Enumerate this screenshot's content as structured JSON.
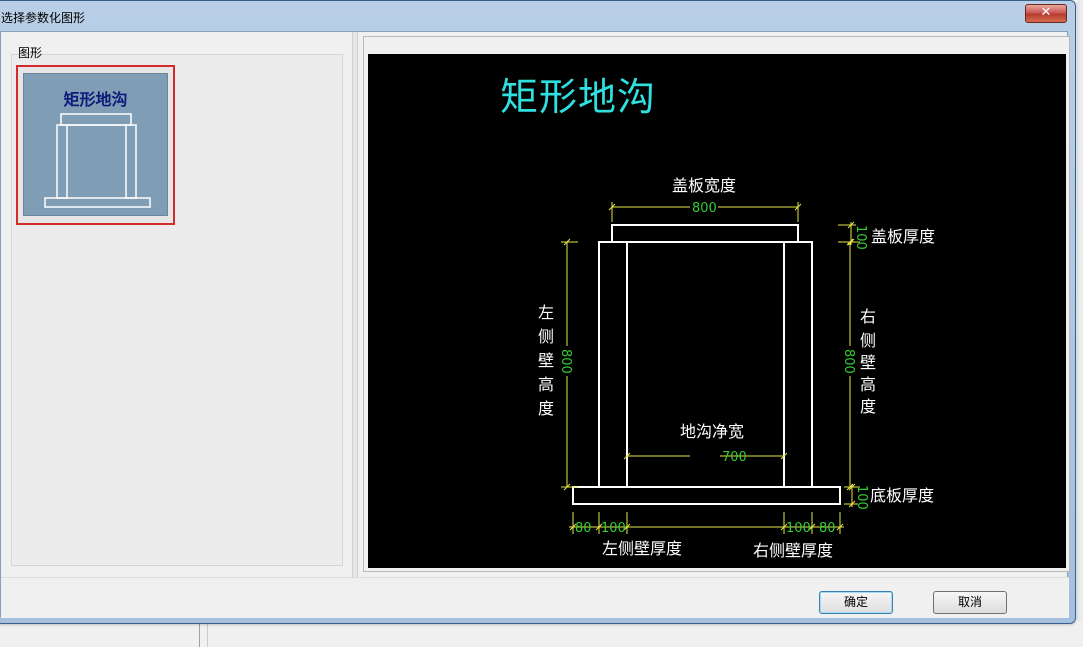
{
  "window": {
    "title": "选择参数化图形",
    "close_label": "✕"
  },
  "left_panel": {
    "group_label": "图形",
    "thumbnail": {
      "title": "矩形地沟",
      "selected": true
    }
  },
  "preview": {
    "title": "矩形地沟",
    "labels": {
      "cover_width": "盖板宽度",
      "cover_thickness": "盖板厚度",
      "left_wall_height": [
        "左",
        "侧",
        "壁",
        "高",
        "度"
      ],
      "right_wall_height": [
        "右",
        "侧",
        "壁",
        "高",
        "度"
      ],
      "clear_width": "地沟净宽",
      "bottom_thickness": "底板厚度",
      "left_wall_thickness": "左侧壁厚度",
      "right_wall_thickness": "右侧壁厚度"
    },
    "dims": {
      "cover_width": "800",
      "cover_thickness": "100",
      "left_wall_height": "800",
      "right_wall_height": "800",
      "clear_width": "700",
      "bottom_thickness": "100",
      "left_overhang": "80",
      "left_wall": "100",
      "right_wall": "100",
      "right_overhang": "80"
    },
    "colors": {
      "title": "#2fe0e0",
      "lines": "#ffffff",
      "dims": "#e6e64a",
      "dim_text": "#33cc33"
    }
  },
  "buttons": {
    "ok": "确定",
    "cancel": "取消"
  }
}
